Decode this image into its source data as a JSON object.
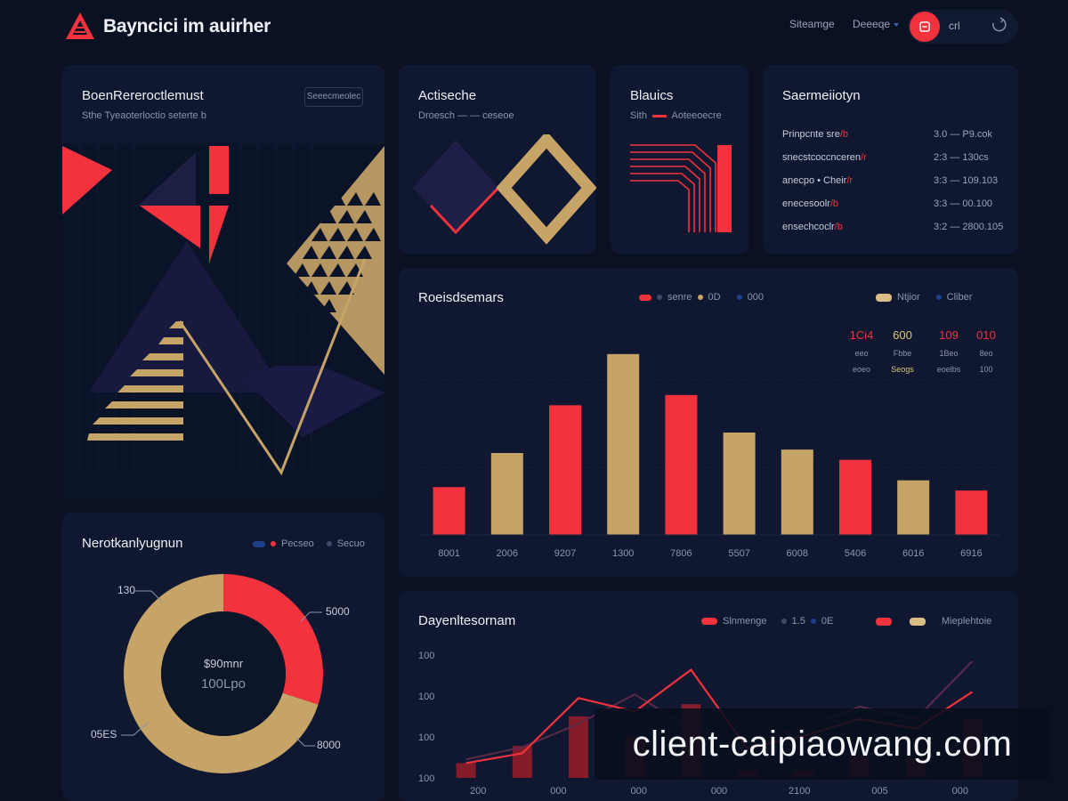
{
  "header": {
    "brand": "Bayncici im auirher",
    "nav": [
      "Siteamge",
      "Deeeqe"
    ],
    "user_label": "crl"
  },
  "hero_card": {
    "title": "BoenRereroctlemust",
    "subtitle": "Sthe Tyeaoterloctio seterte b",
    "button": "Seeecmeolec"
  },
  "shape_card": {
    "title": "Actiseche",
    "subtitle": "Droesch — — ceseoe"
  },
  "balance_card": {
    "title": "Blauics",
    "subtitle": "Sith",
    "subtitle_accent": "Aoteeoecre"
  },
  "stats_card": {
    "title": "Saermeiiotyn",
    "rows": [
      {
        "label": "Prinpcnte sre",
        "accent": "/b",
        "value": "3.0 — P9.cok"
      },
      {
        "label": "snecstcoccnceren",
        "accent": "/r",
        "value": "2:3 — 130cs"
      },
      {
        "label": "anecpo • Cheir",
        "accent": "/r",
        "value": "3:3 — 109.103"
      },
      {
        "label": "enecesoolr",
        "accent": "/b",
        "value": "3:3 — 00.100"
      },
      {
        "label": "ensechcoclr",
        "accent": "/b",
        "value": "3:2 — 2800.105"
      }
    ]
  },
  "bar_card": {
    "title": "Roeisdsemars",
    "legend": [
      "senre",
      "0D",
      "000",
      "Ntjior",
      "Cliber"
    ],
    "stats": [
      {
        "top": "1Ci4",
        "mid": "eeo",
        "bot": "eoeo",
        "color": "#f2323c"
      },
      {
        "top": "600",
        "mid": "Fbbe",
        "bot": "Seogs",
        "color": "#d9c779"
      },
      {
        "top": "109",
        "mid": "1Beo",
        "bot": "eoelbs",
        "color": "#f2323c"
      },
      {
        "top": "010",
        "mid": "8eo",
        "bot": "100",
        "color": "#f2323c"
      }
    ]
  },
  "donut_card": {
    "title": "Nerotkanlyugnun",
    "legend": [
      "Pecseo",
      "Secuo"
    ],
    "center_label": "$90mnr",
    "center_value": "100Lpo",
    "labels": {
      "top_left": "130",
      "top_right": "5000",
      "bottom_left": "05ES",
      "bottom_right": "8000"
    }
  },
  "line_card": {
    "title": "Dayenltesornam",
    "legend": [
      "Slnmenge",
      "1.5",
      "0E",
      "Mieplehtoie"
    ]
  },
  "chart_data": [
    {
      "type": "bar",
      "title": "Roeisdsemars",
      "categories": [
        "8001",
        "2006",
        "9207",
        "1300",
        "7806",
        "5507",
        "6008",
        "5406",
        "6016",
        "6916"
      ],
      "values": [
        28,
        48,
        76,
        106,
        82,
        60,
        50,
        44,
        32,
        26
      ],
      "colors": [
        "red",
        "gold",
        "red",
        "gold",
        "red",
        "gold",
        "gold",
        "red",
        "gold",
        "red"
      ],
      "ylim": [
        0,
        120
      ],
      "grid": true
    },
    {
      "type": "pie",
      "title": "Nerotkanlyugnun",
      "values": [
        30,
        70
      ],
      "colors": [
        "#f2323c",
        "#c6a367"
      ]
    },
    {
      "type": "line",
      "title": "Dayenltesornam",
      "x": [
        "200",
        "000",
        "000",
        "000",
        "2100",
        "005",
        "000"
      ],
      "yticks": [
        "100",
        "100",
        "100",
        "100"
      ],
      "bars": [
        12,
        26,
        50,
        34,
        60,
        6,
        6,
        18,
        16,
        48
      ],
      "series": [
        {
          "values": [
            12,
            20,
            65,
            54,
            88,
            24,
            34,
            48,
            40,
            70
          ]
        },
        {
          "values": [
            15,
            25,
            44,
            68,
            40,
            30,
            40,
            58,
            48,
            95
          ]
        }
      ],
      "ylim": [
        0,
        100
      ]
    }
  ],
  "watermark": "client-caipiaowang.com"
}
